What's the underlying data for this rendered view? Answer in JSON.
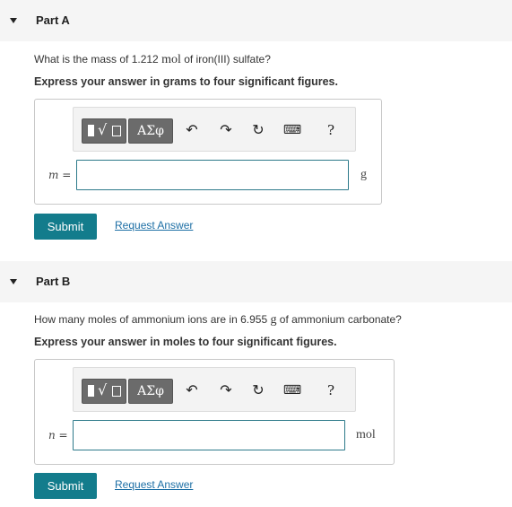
{
  "partA": {
    "title": "Part A",
    "question_pre": "What is the mass of 1.212 ",
    "question_unit": "mol",
    "question_post": " of iron(III) sulfate?",
    "instruction": "Express your answer in grams to four significant figures.",
    "variable": "m =",
    "unit": "g",
    "input_value": "",
    "submit_label": "Submit",
    "request_label": "Request Answer"
  },
  "partB": {
    "title": "Part B",
    "question_pre": "How many moles of ammonium ions are in 6.955 ",
    "question_unit": "g",
    "question_post": " of ammonium carbonate?",
    "instruction": "Express your answer in moles to four significant figures.",
    "variable": "n =",
    "unit": "mol",
    "input_value": "",
    "submit_label": "Submit",
    "request_label": "Request Answer"
  },
  "toolbar": {
    "templates_icon": "templates-radical-icon",
    "greek_label": "ΑΣφ",
    "undo_icon": "undo-icon",
    "redo_icon": "redo-icon",
    "reset_icon": "reset-icon",
    "keyboard_icon": "keyboard-icon",
    "help_label": "?"
  },
  "colors": {
    "accent": "#137c8c",
    "link": "#1d6fa5",
    "header_bg": "#f5f5f5",
    "toolbar_button": "#6b6b6b"
  }
}
